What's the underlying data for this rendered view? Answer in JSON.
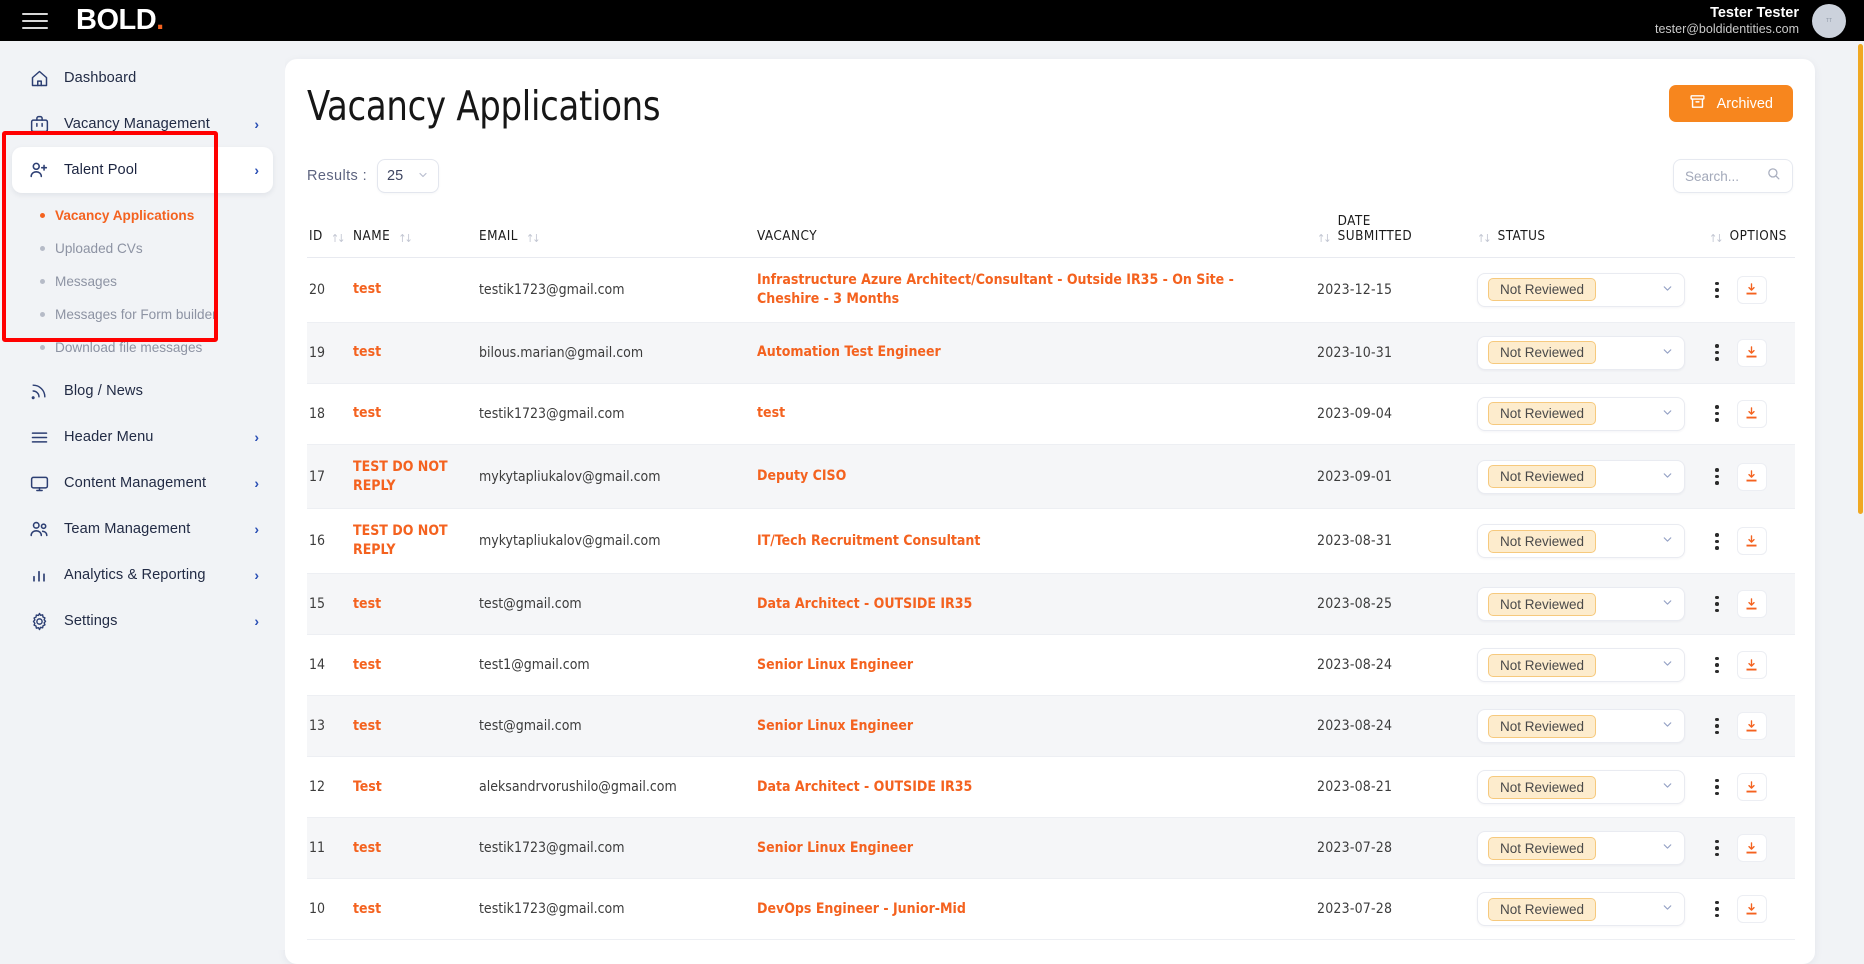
{
  "topbar": {
    "menu_icon": "hamburger-icon",
    "brand": "BOLD",
    "brand_dot": ".",
    "user_name": "Tester Tester",
    "user_email": "tester@boldidentities.com",
    "avatar_label": "TT"
  },
  "sidebar": {
    "items": [
      {
        "label": "Dashboard",
        "icon": "home-icon",
        "chevron": "",
        "active": false
      },
      {
        "label": "Vacancy Management",
        "icon": "briefcase-icon",
        "chevron": "›",
        "active": false
      },
      {
        "label": "Talent Pool",
        "icon": "user-plus-icon",
        "chevron": "›",
        "active": true
      },
      {
        "label": "Blog / News",
        "icon": "rss-icon",
        "chevron": "",
        "active": false
      },
      {
        "label": "Header Menu",
        "icon": "menu-lines-icon",
        "chevron": "›",
        "active": false
      },
      {
        "label": "Content Management",
        "icon": "monitor-icon",
        "chevron": "›",
        "active": false
      },
      {
        "label": "Team Management",
        "icon": "users-icon",
        "chevron": "›",
        "active": false
      },
      {
        "label": "Analytics & Reporting",
        "icon": "bar-chart-icon",
        "chevron": "›",
        "active": false
      },
      {
        "label": "Settings",
        "icon": "gear-icon",
        "chevron": "›",
        "active": false
      }
    ],
    "subitems": [
      {
        "label": "Vacancy Applications",
        "selected": true
      },
      {
        "label": "Uploaded CVs",
        "selected": false
      },
      {
        "label": "Messages",
        "selected": false
      },
      {
        "label": "Messages for Form builder",
        "selected": false
      },
      {
        "label": "Download file messages",
        "selected": false
      }
    ]
  },
  "header": {
    "title": "Vacancy Applications",
    "archived_label": "Archived",
    "archived_icon": "archive-box-icon"
  },
  "toolbar": {
    "results_label": "Results :",
    "results_value": "25",
    "results_options": [
      "25"
    ],
    "search_placeholder": "Search...",
    "search_value": "",
    "search_icon": "search-icon"
  },
  "table": {
    "columns": [
      {
        "label": "ID",
        "sortable": true
      },
      {
        "label": "NAME",
        "sortable": true
      },
      {
        "label": "EMAIL",
        "sortable": true
      },
      {
        "label": "VACANCY",
        "sortable": true
      },
      {
        "label": "DATE SUBMITTED",
        "sortable": true
      },
      {
        "label": "STATUS",
        "sortable": true
      },
      {
        "label": "OPTIONS",
        "sortable": false
      }
    ],
    "status_default": "Not Reviewed",
    "rows": [
      {
        "id": "20",
        "name": "test",
        "email": "testik1723@gmail.com",
        "vacancy": "Infrastructure Azure Architect/Consultant - Outside IR35 - On Site - Cheshire - 3 Months",
        "date": "2023-12-15",
        "status": "Not Reviewed"
      },
      {
        "id": "19",
        "name": "test",
        "email": "bilous.marian@gmail.com",
        "vacancy": "Automation Test Engineer",
        "date": "2023-10-31",
        "status": "Not Reviewed"
      },
      {
        "id": "18",
        "name": "test",
        "email": "testik1723@gmail.com",
        "vacancy": "test",
        "date": "2023-09-04",
        "status": "Not Reviewed"
      },
      {
        "id": "17",
        "name": "TEST DO NOT REPLY",
        "email": "mykytapliukalov@gmail.com",
        "vacancy": "Deputy CISO",
        "date": "2023-09-01",
        "status": "Not Reviewed"
      },
      {
        "id": "16",
        "name": "TEST DO NOT REPLY",
        "email": "mykytapliukalov@gmail.com",
        "vacancy": "IT/Tech Recruitment Consultant",
        "date": "2023-08-31",
        "status": "Not Reviewed"
      },
      {
        "id": "15",
        "name": "test",
        "email": "test@gmail.com",
        "vacancy": "Data Architect - OUTSIDE IR35",
        "date": "2023-08-25",
        "status": "Not Reviewed"
      },
      {
        "id": "14",
        "name": "test",
        "email": "test1@gmail.com",
        "vacancy": "Senior Linux Engineer",
        "date": "2023-08-24",
        "status": "Not Reviewed"
      },
      {
        "id": "13",
        "name": "test",
        "email": "test@gmail.com",
        "vacancy": "Senior Linux Engineer",
        "date": "2023-08-24",
        "status": "Not Reviewed"
      },
      {
        "id": "12",
        "name": "Test",
        "email": "aleksandrvorushilo@gmail.com",
        "vacancy": "Data Architect - OUTSIDE IR35",
        "date": "2023-08-21",
        "status": "Not Reviewed"
      },
      {
        "id": "11",
        "name": "test",
        "email": "testik1723@gmail.com",
        "vacancy": "Senior Linux Engineer",
        "date": "2023-07-28",
        "status": "Not Reviewed"
      },
      {
        "id": "10",
        "name": "test",
        "email": "testik1723@gmail.com",
        "vacancy": "DevOps Engineer - Junior-Mid",
        "date": "2023-07-28",
        "status": "Not Reviewed"
      }
    ],
    "row_icons": {
      "kebab": "kebab-menu-icon",
      "download": "download-icon"
    }
  },
  "colors": {
    "accent_orange": "#f4621f",
    "button_orange": "#f7861e",
    "annotation_red": "#ff0000",
    "topbar_black": "#000000",
    "page_bg": "#f1f3f6",
    "scrollbar": "#f0a822"
  }
}
